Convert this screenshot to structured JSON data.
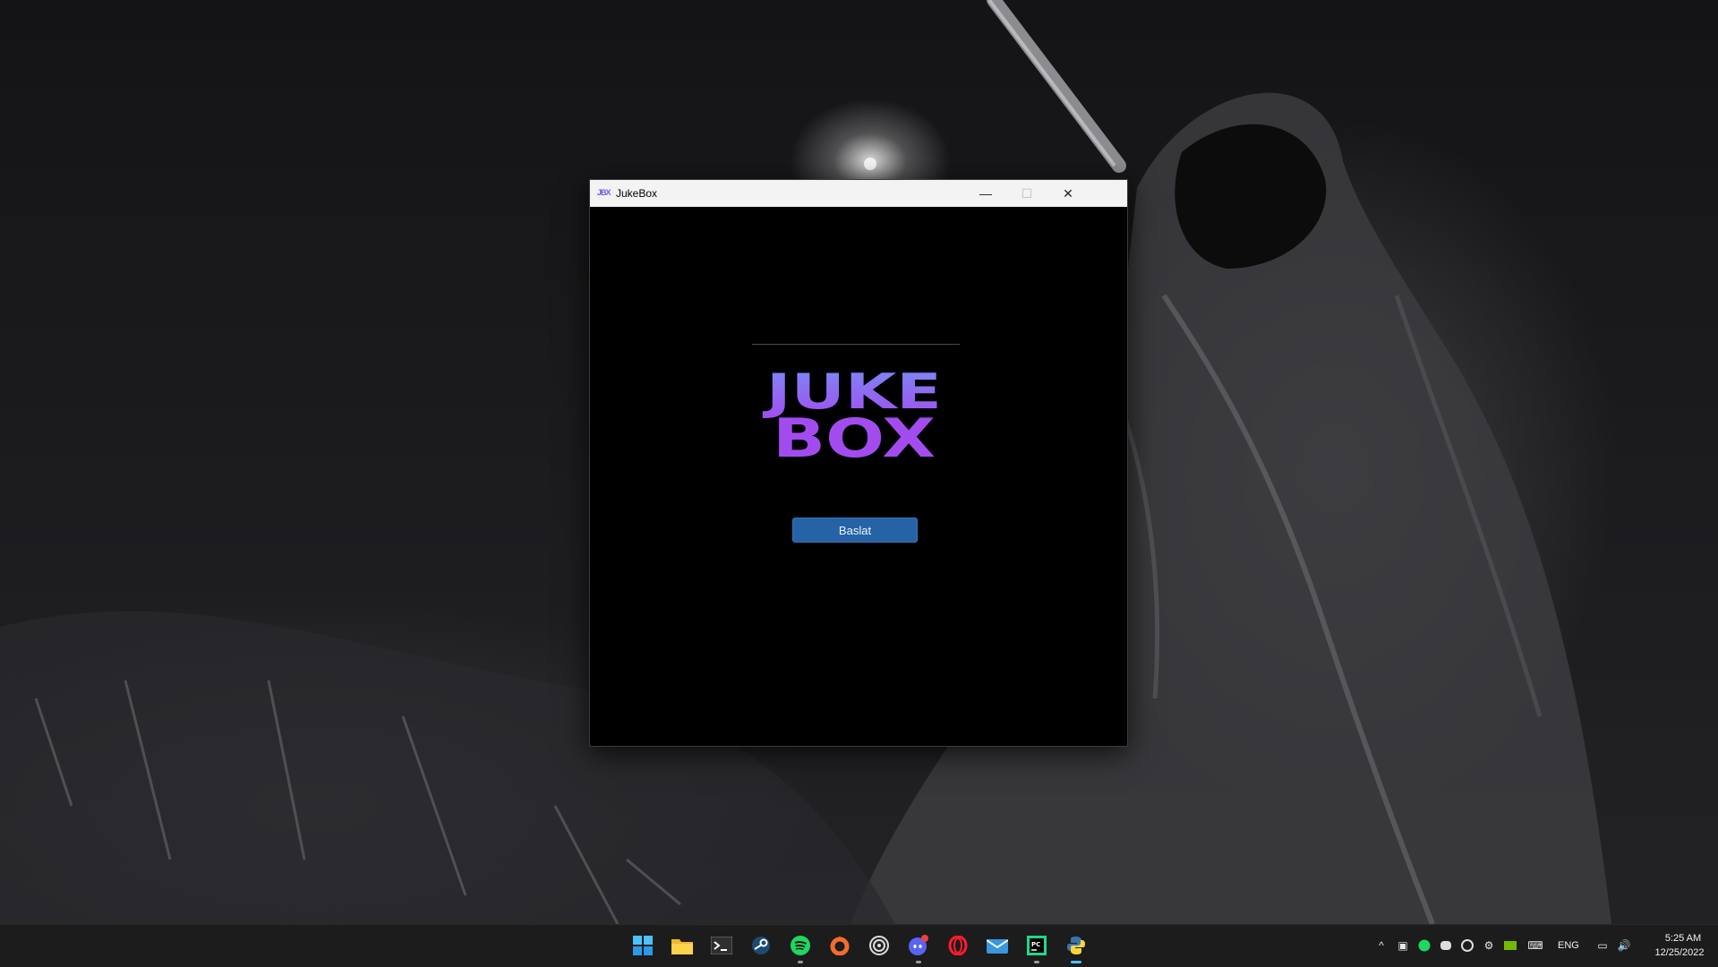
{
  "window": {
    "title": "JukeBox",
    "icon_text": "JBX"
  },
  "logo": {
    "line1": "JUKE",
    "line2": "BOX",
    "colors": [
      "#7b8cf5",
      "#a24cf0"
    ]
  },
  "main": {
    "start_label": "Baslat"
  },
  "taskbar": {
    "apps": [
      {
        "name": "start",
        "icon": "windows-logo-icon"
      },
      {
        "name": "file-explorer",
        "icon": "folder-icon"
      },
      {
        "name": "terminal",
        "icon": "terminal-icon"
      },
      {
        "name": "steam",
        "icon": "steam-icon"
      },
      {
        "name": "spotify",
        "icon": "spotify-icon"
      },
      {
        "name": "origin",
        "icon": "origin-icon"
      },
      {
        "name": "ubisoft",
        "icon": "ubisoft-icon"
      },
      {
        "name": "discord",
        "icon": "discord-icon"
      },
      {
        "name": "opera",
        "icon": "opera-icon"
      },
      {
        "name": "mail",
        "icon": "mail-icon"
      },
      {
        "name": "pycharm",
        "icon": "pycharm-icon",
        "icon_text": "PC"
      },
      {
        "name": "python",
        "icon": "python-icon"
      }
    ],
    "tray": {
      "language": "ENG",
      "time": "5:25 AM",
      "date": "12/25/2022"
    }
  }
}
